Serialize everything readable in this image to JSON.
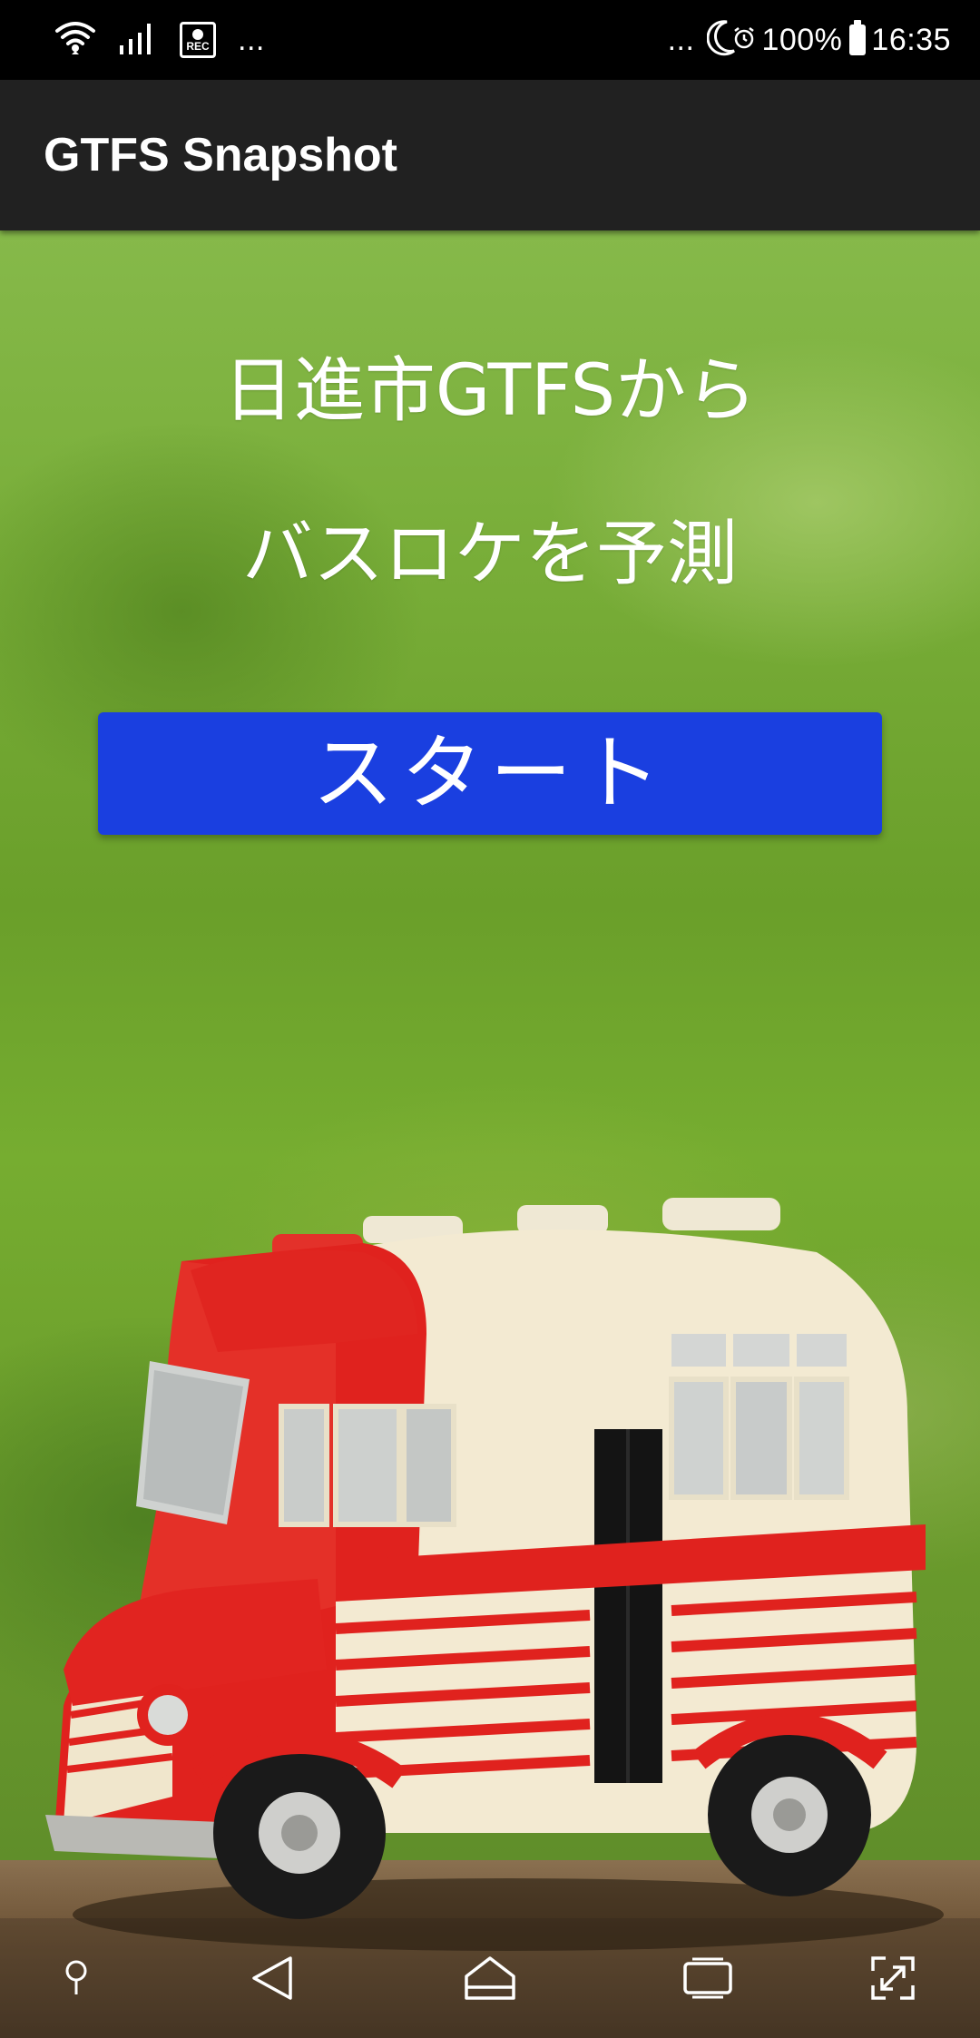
{
  "status_bar": {
    "left_overflow": "...",
    "right_overflow": "...",
    "battery_percent": "100%",
    "time": "16:35",
    "rec_label": "REC",
    "icons": [
      "wifi-icon",
      "signal-icon",
      "screen-record-icon",
      "do-not-disturb-moon-icon",
      "alarm-icon",
      "battery-icon"
    ]
  },
  "app_bar": {
    "title": "GTFS Snapshot"
  },
  "main": {
    "headline_line1": "日進市GTFSから",
    "headline_line2": "バスロケを予測",
    "start_button_label": "スタート"
  },
  "nav_bar": {
    "icons": [
      "pin-icon",
      "back-icon",
      "home-icon",
      "recents-icon",
      "screenshot-expand-icon"
    ]
  },
  "colors": {
    "status_bar_bg": "#000000",
    "app_bar_bg": "#212121",
    "start_button_bg": "#1a3fe0",
    "text": "#ffffff",
    "bus_red": "#e0221e",
    "bus_cream": "#f3ead2",
    "grass_green": "#78ad38"
  }
}
